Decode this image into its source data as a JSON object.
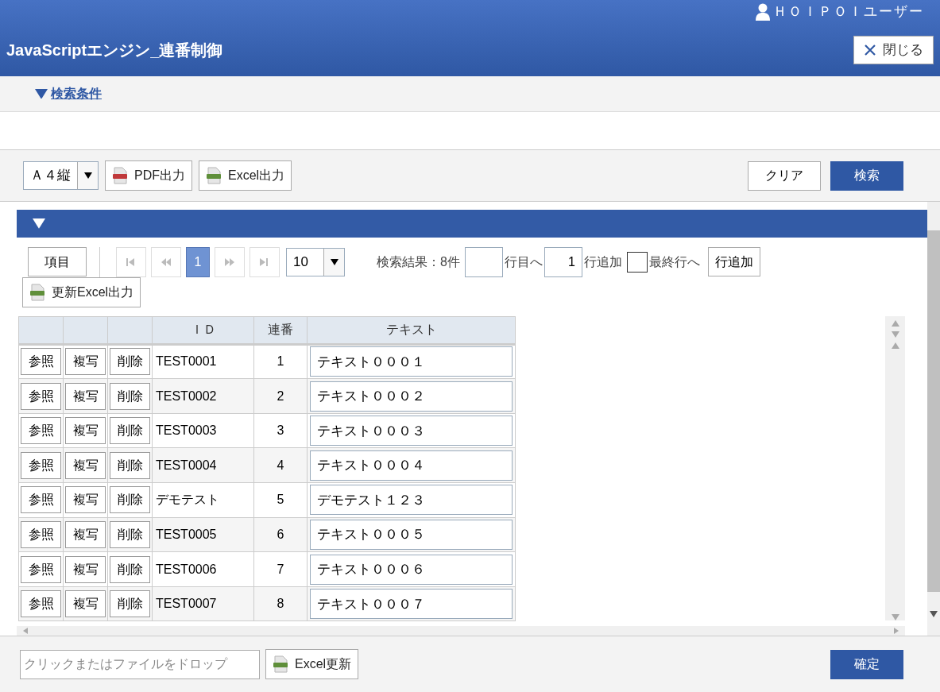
{
  "header": {
    "user": "ＨＯＩＰＯＩユーザー",
    "title": "JavaScriptエンジン_連番制御",
    "close_button": "閉じる"
  },
  "search_conditions": {
    "label": "検索条件",
    "expanded": false
  },
  "toolbar": {
    "paper_select": "Ａ４縦",
    "pdf_button": "PDF出力",
    "excel_button": "Excel出力",
    "clear_button": "クリア",
    "search_button": "検索"
  },
  "results": {
    "items_button": "項目",
    "pager": [
      {
        "kind": "first",
        "disabled": true
      },
      {
        "kind": "prev",
        "disabled": true
      },
      {
        "kind": "page",
        "label": "1",
        "selected": true
      },
      {
        "kind": "next",
        "disabled": true
      },
      {
        "kind": "last",
        "disabled": true
      }
    ],
    "page_size": "10",
    "count": "検索結果：8件",
    "goto_row_label": "行目へ",
    "add_rows_value": "1",
    "add_rows_label": "行追加",
    "last_row_checked": false,
    "last_row_label": "最終行へ",
    "add_row_button": "行追加",
    "update_excel_button": "更新Excel出力"
  },
  "table": {
    "columns": [
      "",
      "",
      "",
      "ＩＤ",
      "連番",
      "テキスト"
    ],
    "rows": [
      {
        "view": "参照",
        "copy": "複写",
        "delete": "削除",
        "id": "TEST0001",
        "seq": "1",
        "text": "テキスト０００１"
      },
      {
        "view": "参照",
        "copy": "複写",
        "delete": "削除",
        "id": "TEST0002",
        "seq": "2",
        "text": "テキスト０００２"
      },
      {
        "view": "参照",
        "copy": "複写",
        "delete": "削除",
        "id": "TEST0003",
        "seq": "3",
        "text": "テキスト０００３"
      },
      {
        "view": "参照",
        "copy": "複写",
        "delete": "削除",
        "id": "TEST0004",
        "seq": "4",
        "text": "テキスト０００４"
      },
      {
        "view": "参照",
        "copy": "複写",
        "delete": "削除",
        "id": "デモテスト",
        "seq": "5",
        "text": "デモテスト１２３"
      },
      {
        "view": "参照",
        "copy": "複写",
        "delete": "削除",
        "id": "TEST0005",
        "seq": "6",
        "text": "テキスト０００５"
      },
      {
        "view": "参照",
        "copy": "複写",
        "delete": "削除",
        "id": "TEST0006",
        "seq": "7",
        "text": "テキスト０００６"
      },
      {
        "view": "参照",
        "copy": "複写",
        "delete": "削除",
        "id": "TEST0007",
        "seq": "8",
        "text": "テキスト０００７"
      }
    ]
  },
  "footer": {
    "file_drop_placeholder": "クリックまたはファイルをドロップ",
    "excel_update_button": "Excel更新",
    "confirm_button": "確定"
  }
}
